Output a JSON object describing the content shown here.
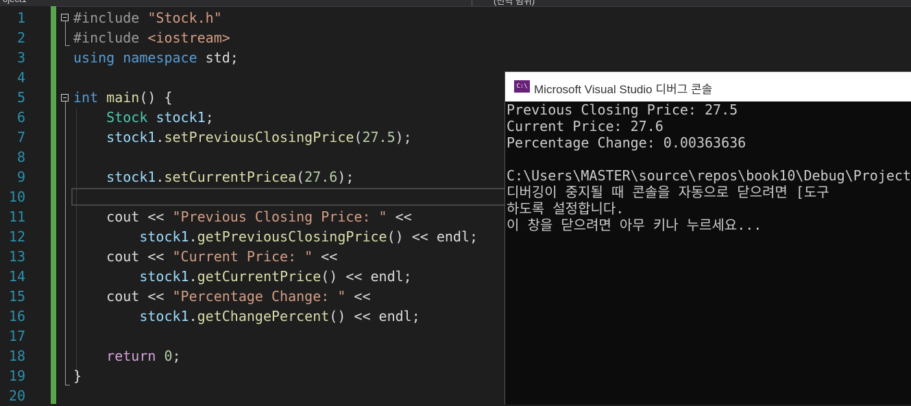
{
  "editor": {
    "line_numbers": [
      "1",
      "2",
      "3",
      "4",
      "5",
      "6",
      "7",
      "8",
      "9",
      "10",
      "11",
      "12",
      "13",
      "14",
      "15",
      "16",
      "17",
      "18",
      "19",
      "20"
    ],
    "lines": [
      [
        {
          "t": "#include ",
          "c": "pre"
        },
        {
          "t": "\"Stock.h\"",
          "c": "str"
        }
      ],
      [
        {
          "t": "#include ",
          "c": "pre"
        },
        {
          "t": "<iostream>",
          "c": "str"
        }
      ],
      [
        {
          "t": "using",
          "c": "kw"
        },
        {
          "t": " "
        },
        {
          "t": "namespace",
          "c": "kw"
        },
        {
          "t": " std;"
        }
      ],
      [],
      [
        {
          "t": "int",
          "c": "kw"
        },
        {
          "t": " "
        },
        {
          "t": "main",
          "c": "fn"
        },
        {
          "t": "() {"
        }
      ],
      [
        {
          "t": "    "
        },
        {
          "t": "Stock",
          "c": "cls"
        },
        {
          "t": " "
        },
        {
          "t": "stock1",
          "c": "var"
        },
        {
          "t": ";"
        }
      ],
      [
        {
          "t": "    "
        },
        {
          "t": "stock1",
          "c": "var"
        },
        {
          "t": "."
        },
        {
          "t": "setPreviousClosingPrice",
          "c": "fn"
        },
        {
          "t": "("
        },
        {
          "t": "27.5",
          "c": "num"
        },
        {
          "t": ");"
        }
      ],
      [],
      [
        {
          "t": "    "
        },
        {
          "t": "stock1",
          "c": "var"
        },
        {
          "t": "."
        },
        {
          "t": "setCurrentPricea",
          "c": "fn"
        },
        {
          "t": "("
        },
        {
          "t": "27.6",
          "c": "num"
        },
        {
          "t": ");"
        }
      ],
      [],
      [
        {
          "t": "    cout << "
        },
        {
          "t": "\"Previous Closing Price: \"",
          "c": "str"
        },
        {
          "t": " <<"
        }
      ],
      [
        {
          "t": "        "
        },
        {
          "t": "stock1",
          "c": "var"
        },
        {
          "t": "."
        },
        {
          "t": "getPreviousClosingPrice",
          "c": "fn"
        },
        {
          "t": "() << endl;"
        }
      ],
      [
        {
          "t": "    cout << "
        },
        {
          "t": "\"Current Price: \"",
          "c": "str"
        },
        {
          "t": " <<"
        }
      ],
      [
        {
          "t": "        "
        },
        {
          "t": "stock1",
          "c": "var"
        },
        {
          "t": "."
        },
        {
          "t": "getCurrentPrice",
          "c": "fn"
        },
        {
          "t": "() << endl;"
        }
      ],
      [
        {
          "t": "    cout << "
        },
        {
          "t": "\"Percentage Change: \"",
          "c": "str"
        },
        {
          "t": " <<"
        }
      ],
      [
        {
          "t": "        "
        },
        {
          "t": "stock1",
          "c": "var"
        },
        {
          "t": "."
        },
        {
          "t": "getChangePercent",
          "c": "fn"
        },
        {
          "t": "() << endl;"
        }
      ],
      [],
      [
        {
          "t": "    "
        },
        {
          "t": "return",
          "c": "flow"
        },
        {
          "t": " "
        },
        {
          "t": "0",
          "c": "num"
        },
        {
          "t": ";"
        }
      ],
      [
        {
          "t": "}"
        }
      ],
      []
    ]
  },
  "console": {
    "icon": "C:\\",
    "title": "Microsoft Visual Studio 디버그 콘솔",
    "lines": [
      "Previous Closing Price: 27.5",
      "Current Price: 27.6",
      "Percentage Change: 0.00363636",
      "",
      "C:\\Users\\MASTER\\source\\repos\\book10\\Debug\\Project",
      "디버깅이 중지될 때 콘솔을 자동으로 닫으려면 [도구",
      "하도록 설정합니다.",
      "이 창을 닫으려면 아무 키나 누르세요..."
    ]
  }
}
